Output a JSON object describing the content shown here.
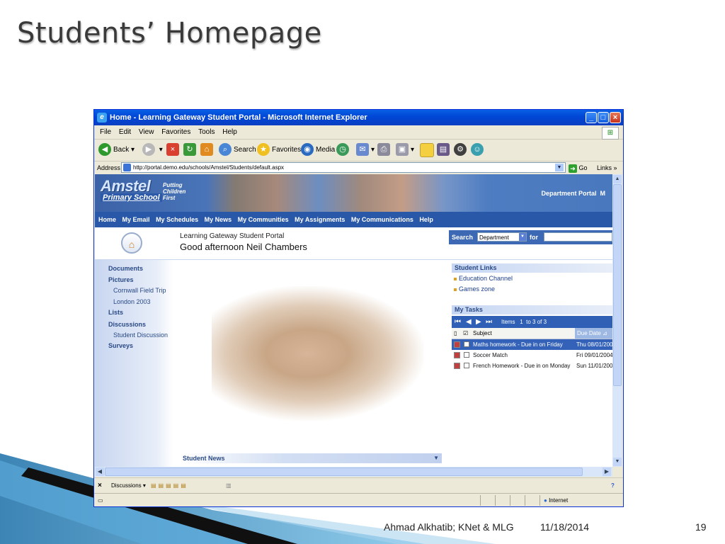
{
  "slide": {
    "title": "Students’ Homepage",
    "footer_author": "Ahmad Alkhatib; KNet & MLG",
    "footer_date": "11/18/2014",
    "page_number": "19"
  },
  "browser": {
    "title": "Home - Learning Gateway Student Portal - Microsoft Internet Explorer",
    "menu": [
      "File",
      "Edit",
      "View",
      "Favorites",
      "Tools",
      "Help"
    ],
    "toolbar": {
      "back": "Back",
      "search": "Search",
      "favorites": "Favorites",
      "media": "Media"
    },
    "address_label": "Address",
    "address_url": "http://portal.demo.edu/schools/Amstel/Students/default.aspx",
    "go": "Go",
    "links": "Links",
    "links_toolbar": "Discussions",
    "status_zone": "Internet"
  },
  "portal": {
    "logo_line1": "Amstel",
    "logo_line2": "Primary School",
    "slogan": [
      "Putting",
      "Children",
      "First"
    ],
    "department_portal": "Department Portal",
    "dept_overflow": "M",
    "nav": [
      "Home",
      "My Email",
      "My Schedules",
      "My News",
      "My Communities",
      "My Assignments",
      "My Communications",
      "Help"
    ],
    "welcome_small": "Learning Gateway Student Portal",
    "welcome_big": "Good afternoon Neil Chambers",
    "search_label": "Search",
    "search_scope": "Department",
    "search_for": "for",
    "left_nav": [
      {
        "label": "Documents",
        "type": "heading"
      },
      {
        "label": "Pictures",
        "type": "heading"
      },
      {
        "label": "Cornwall Field Trip",
        "type": "sub"
      },
      {
        "label": "London 2003",
        "type": "sub"
      },
      {
        "label": "Lists",
        "type": "heading"
      },
      {
        "label": "Discussions",
        "type": "heading"
      },
      {
        "label": "Student Discussion",
        "type": "sub"
      },
      {
        "label": "Surveys",
        "type": "heading"
      }
    ],
    "student_news": "Student News",
    "student_links_title": "Student Links",
    "student_links": [
      "Education Channel",
      "Games zone"
    ],
    "my_tasks_title": "My Tasks",
    "tasks_items_label": "Items   1  to 3 of 3",
    "tasks_col_subject": "Subject",
    "tasks_col_due": "Due Date",
    "tasks": [
      {
        "subject": "Maths homework - Due in on Friday",
        "due": "Thu 08/01/200",
        "selected": true
      },
      {
        "subject": "Soccer Match",
        "due": "Fri 09/01/2004",
        "selected": false
      },
      {
        "subject": "French Homework - Due in on Monday",
        "due": "Sun 11/01/200",
        "selected": false
      }
    ]
  },
  "colors": {
    "xp_title_blue": "#0a5fe6",
    "portal_nav_blue": "#2a58a8",
    "task_selected": "#3462b8"
  }
}
